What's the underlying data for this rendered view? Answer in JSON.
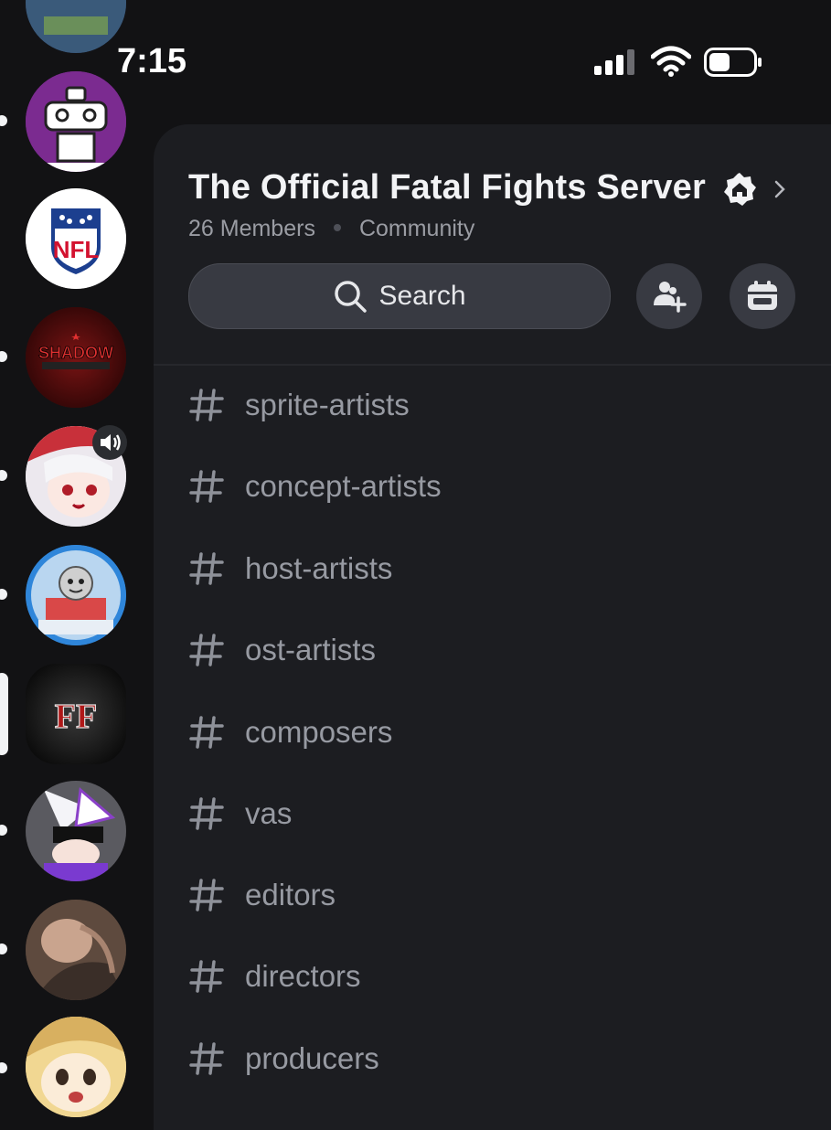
{
  "status_bar": {
    "time": "7:15"
  },
  "server": {
    "title": "The Official Fatal Fights Server",
    "members": "26 Members",
    "type": "Community"
  },
  "search": {
    "label": "Search"
  },
  "channels": [
    "sprite-artists",
    "concept-artists",
    "host-artists",
    "ost-artists",
    "composers",
    "vas",
    "editors",
    "directors",
    "producers"
  ],
  "server_icons": [
    {
      "name": "server-partial-top"
    },
    {
      "name": "server-robot"
    },
    {
      "name": "server-nfl",
      "text": "NFL"
    },
    {
      "name": "server-shadow-revolution",
      "text": "SHADOW"
    },
    {
      "name": "server-anime-girl"
    },
    {
      "name": "server-thomas"
    },
    {
      "name": "server-fatal-fights",
      "text": "FF"
    },
    {
      "name": "server-purple-character"
    },
    {
      "name": "server-dark-art"
    },
    {
      "name": "server-blonde-character"
    }
  ],
  "colors": {
    "background": "#121214",
    "panel": "#1c1d21",
    "search": "#383a42",
    "channel_text": "#979aa2",
    "title_text": "#f2f3f5"
  }
}
